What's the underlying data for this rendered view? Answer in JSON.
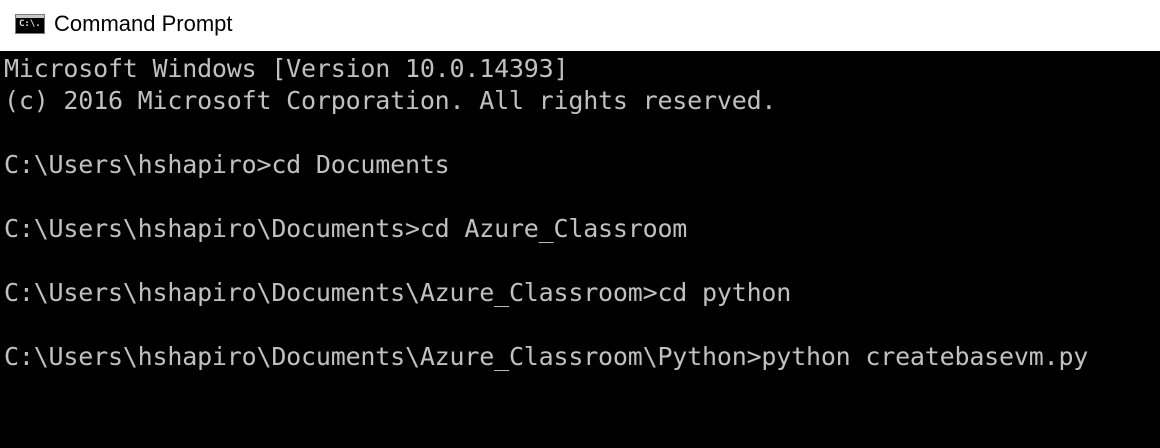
{
  "window": {
    "title": "Command Prompt",
    "icon": "cmd-icon",
    "icon_glyph": "C:\\."
  },
  "console": {
    "lines": [
      "Microsoft Windows [Version 10.0.14393]",
      "(c) 2016 Microsoft Corporation. All rights reserved.",
      "",
      "C:\\Users\\hshapiro>cd Documents",
      "",
      "C:\\Users\\hshapiro\\Documents>cd Azure_Classroom",
      "",
      "C:\\Users\\hshapiro\\Documents\\Azure_Classroom>cd python",
      "",
      "C:\\Users\\hshapiro\\Documents\\Azure_Classroom\\Python>python createbasevm.py"
    ]
  },
  "colors": {
    "console_background": "#000000",
    "console_text": "#c0c0c0",
    "titlebar_background": "#ffffff",
    "title_text": "#000000"
  }
}
